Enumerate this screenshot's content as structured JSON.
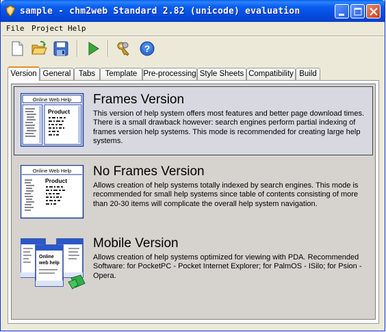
{
  "window": {
    "title": "sample - chm2web Standard 2.82 (unicode) evaluation",
    "controls": [
      "minimize",
      "maximize",
      "close"
    ]
  },
  "menu": {
    "items": [
      "File",
      "Project",
      "Help"
    ]
  },
  "toolbar": {
    "buttons": [
      {
        "name": "new-icon"
      },
      {
        "name": "open-folder-icon"
      },
      {
        "name": "save-icon"
      },
      {
        "name": "run-icon"
      },
      {
        "name": "keys-icon"
      },
      {
        "name": "help-icon"
      }
    ]
  },
  "tabs": {
    "items": [
      "Version",
      "General",
      "Tabs",
      "Template",
      "Pre-processing",
      "Style Sheets",
      "Compatibility",
      "Build"
    ],
    "active": "Version"
  },
  "versions": {
    "frames": {
      "title": "Frames Version",
      "description": "This version of help system offers most features and better page download times. There is a small drawback however: search engines perform partial indexing of frames version help systems. This mode is recommended for creating large help systems.",
      "thumb_header": "Online Web Help",
      "thumb_heading": "Product",
      "selected": true
    },
    "noframes": {
      "title": "No Frames Version",
      "description": "Allows creation of help systems totally indexed by search engines. This mode is recommended for small help systems since table of contents consisting of more than 20-30 items will complicate the overall help system navigation.",
      "thumb_header": "Online Web Help",
      "thumb_heading": "Product",
      "selected": false
    },
    "mobile": {
      "title": "Mobile Version",
      "description": "Allows creation of help systems optimized for viewing with PDA. Recommended Software: for PocketPC - Pocket Internet Explorer; for PalmOS - ISilo; for Psion - Opera.",
      "thumb_lines": [
        "Online",
        "web help"
      ],
      "selected": false
    }
  },
  "colors": {
    "titlebar": "#0a5ef2",
    "face": "#ece9d8",
    "panel": "#d6d3ce",
    "selection_border": "#404050",
    "tab_accent": "#e68b2c"
  }
}
